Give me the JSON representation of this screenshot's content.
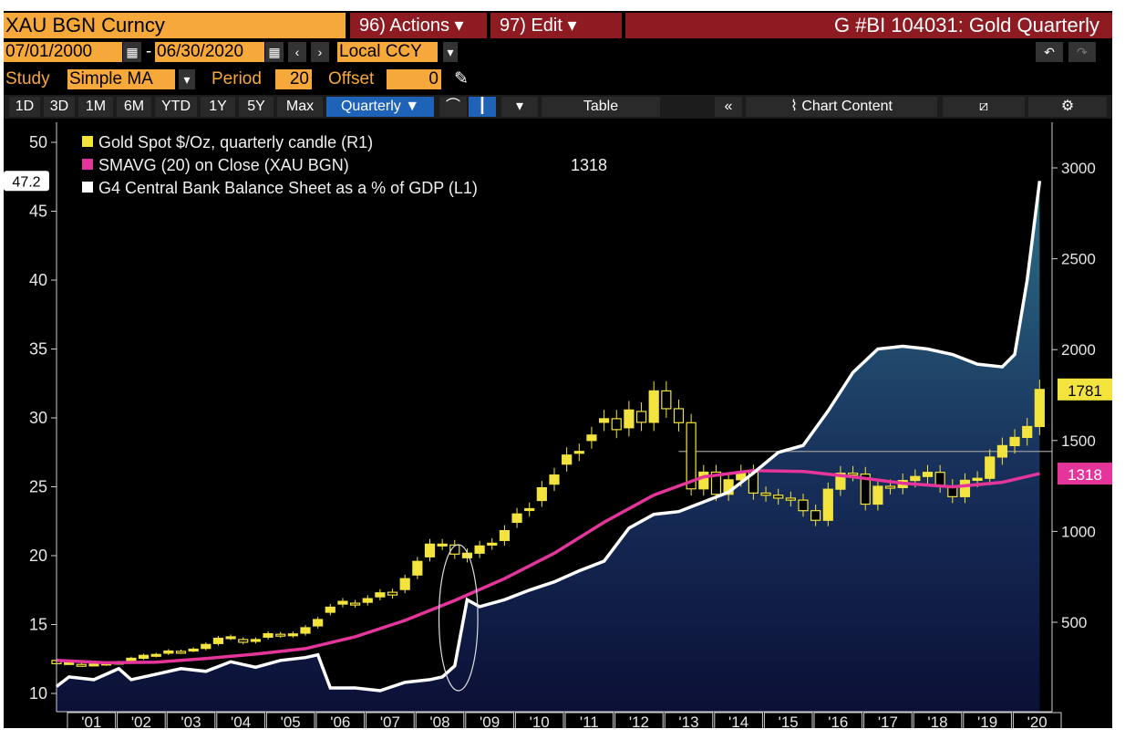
{
  "header": {
    "ticker": "XAU BGN Curncy",
    "actions_label": "96) Actions",
    "edit_label": "97) Edit",
    "title": "G #BI 104031: Gold Quarterly",
    "start_date": "07/01/2000",
    "end_date": "06/30/2020",
    "currency": "Local CCY",
    "study_label": "Study",
    "study_value": "Simple MA",
    "period_label": "Period",
    "period_value": "20",
    "offset_label": "Offset",
    "offset_value": "0"
  },
  "toolbar": {
    "tabs": [
      "1D",
      "3D",
      "1M",
      "6M",
      "YTD",
      "1Y",
      "5Y",
      "Max"
    ],
    "period_select": "Quarterly ▼",
    "table_label": "Table",
    "chart_content_label": "Chart Content"
  },
  "colors": {
    "background": "#000000",
    "gold": "#f2e33f",
    "ma": "#e3359a",
    "balance_sheet_line": "#ffffff",
    "orange": "#f7a83a",
    "dark_red": "#8e1b22",
    "selected_tab": "#1f63b8"
  },
  "chart_data": {
    "type": "line",
    "legend": [
      "Gold Spot $/Oz, quarterly candle (R1)",
      "SMAVG (20)  on Close (XAU BGN)",
      "G4 Central Bank Balance Sheet as a % of GDP (L1)"
    ],
    "legend_ma_value": "1318",
    "x_ticks": [
      "'01",
      "'02",
      "'03",
      "'04",
      "'05",
      "'06",
      "'07",
      "'08",
      "'09",
      "'10",
      "'11",
      "'12",
      "'13",
      "'14",
      "'15",
      "'16",
      "'17",
      "'18",
      "'19",
      "'20"
    ],
    "left_axis": {
      "ylim": [
        9,
        50
      ],
      "ticks": [
        "50",
        "45",
        "40",
        "35",
        "30",
        "25",
        "20",
        "15",
        "10"
      ]
    },
    "right_axis": {
      "ticks": [
        "3000",
        "2500",
        "2000",
        "1500",
        "1000",
        "500"
      ]
    },
    "left_marker": "47.2",
    "right_markers": [
      "1781",
      "1318"
    ],
    "gold_candles": [
      {
        "x": 2000.5,
        "o": 290,
        "c": 272
      },
      {
        "x": 2000.75,
        "o": 274,
        "c": 278
      },
      {
        "x": 2001.0,
        "o": 268,
        "c": 265
      },
      {
        "x": 2001.25,
        "o": 266,
        "c": 270
      },
      {
        "x": 2001.5,
        "o": 268,
        "c": 275
      },
      {
        "x": 2001.75,
        "o": 276,
        "c": 280
      },
      {
        "x": 2002.0,
        "o": 290,
        "c": 302
      },
      {
        "x": 2002.25,
        "o": 302,
        "c": 318
      },
      {
        "x": 2002.5,
        "o": 316,
        "c": 323
      },
      {
        "x": 2002.75,
        "o": 330,
        "c": 342
      },
      {
        "x": 2003.0,
        "o": 340,
        "c": 336
      },
      {
        "x": 2003.25,
        "o": 346,
        "c": 352
      },
      {
        "x": 2003.5,
        "o": 356,
        "c": 378
      },
      {
        "x": 2003.75,
        "o": 383,
        "c": 412
      },
      {
        "x": 2004.0,
        "o": 414,
        "c": 420
      },
      {
        "x": 2004.25,
        "o": 405,
        "c": 390
      },
      {
        "x": 2004.5,
        "o": 395,
        "c": 405
      },
      {
        "x": 2004.75,
        "o": 418,
        "c": 437
      },
      {
        "x": 2005.0,
        "o": 434,
        "c": 427
      },
      {
        "x": 2005.25,
        "o": 428,
        "c": 436
      },
      {
        "x": 2005.5,
        "o": 440,
        "c": 470
      },
      {
        "x": 2005.75,
        "o": 480,
        "c": 515
      },
      {
        "x": 2006.0,
        "o": 555,
        "c": 583
      },
      {
        "x": 2006.25,
        "o": 600,
        "c": 615
      },
      {
        "x": 2006.5,
        "o": 605,
        "c": 598
      },
      {
        "x": 2006.75,
        "o": 610,
        "c": 630
      },
      {
        "x": 2007.0,
        "o": 640,
        "c": 662
      },
      {
        "x": 2007.25,
        "o": 665,
        "c": 650
      },
      {
        "x": 2007.5,
        "o": 680,
        "c": 740
      },
      {
        "x": 2007.75,
        "o": 760,
        "c": 835
      },
      {
        "x": 2008.0,
        "o": 860,
        "c": 930
      },
      {
        "x": 2008.25,
        "o": 925,
        "c": 930
      },
      {
        "x": 2008.5,
        "o": 925,
        "c": 875
      },
      {
        "x": 2008.75,
        "o": 855,
        "c": 880
      },
      {
        "x": 2009.0,
        "o": 880,
        "c": 920
      },
      {
        "x": 2009.25,
        "o": 926,
        "c": 935
      },
      {
        "x": 2009.5,
        "o": 950,
        "c": 1004
      },
      {
        "x": 2009.75,
        "o": 1050,
        "c": 1096
      },
      {
        "x": 2010.0,
        "o": 1115,
        "c": 1125
      },
      {
        "x": 2010.25,
        "o": 1170,
        "c": 1240
      },
      {
        "x": 2010.5,
        "o": 1260,
        "c": 1310
      },
      {
        "x": 2010.75,
        "o": 1370,
        "c": 1420
      },
      {
        "x": 2011.0,
        "o": 1430,
        "c": 1440
      },
      {
        "x": 2011.25,
        "o": 1500,
        "c": 1530
      },
      {
        "x": 2011.5,
        "o": 1600,
        "c": 1620
      },
      {
        "x": 2011.75,
        "o": 1620,
        "c": 1560
      },
      {
        "x": 2012.0,
        "o": 1570,
        "c": 1668
      },
      {
        "x": 2012.25,
        "o": 1660,
        "c": 1600
      },
      {
        "x": 2012.5,
        "o": 1600,
        "c": 1773
      },
      {
        "x": 2012.75,
        "o": 1773,
        "c": 1675
      },
      {
        "x": 2013.0,
        "o": 1675,
        "c": 1598
      },
      {
        "x": 2013.25,
        "o": 1598,
        "c": 1234
      },
      {
        "x": 2013.5,
        "o": 1234,
        "c": 1326
      },
      {
        "x": 2013.75,
        "o": 1326,
        "c": 1204
      },
      {
        "x": 2014.0,
        "o": 1204,
        "c": 1284
      },
      {
        "x": 2014.25,
        "o": 1284,
        "c": 1327
      },
      {
        "x": 2014.5,
        "o": 1327,
        "c": 1211
      },
      {
        "x": 2014.75,
        "o": 1211,
        "c": 1199
      },
      {
        "x": 2015.0,
        "o": 1199,
        "c": 1183
      },
      {
        "x": 2015.25,
        "o": 1183,
        "c": 1172
      },
      {
        "x": 2015.5,
        "o": 1172,
        "c": 1114
      },
      {
        "x": 2015.75,
        "o": 1114,
        "c": 1061
      },
      {
        "x": 2016.0,
        "o": 1061,
        "c": 1232
      },
      {
        "x": 2016.25,
        "o": 1232,
        "c": 1320
      },
      {
        "x": 2016.5,
        "o": 1320,
        "c": 1315
      },
      {
        "x": 2016.75,
        "o": 1315,
        "c": 1150
      },
      {
        "x": 2017.0,
        "o": 1150,
        "c": 1248
      },
      {
        "x": 2017.25,
        "o": 1248,
        "c": 1241
      },
      {
        "x": 2017.5,
        "o": 1241,
        "c": 1280
      },
      {
        "x": 2017.75,
        "o": 1280,
        "c": 1302
      },
      {
        "x": 2018.0,
        "o": 1302,
        "c": 1325
      },
      {
        "x": 2018.25,
        "o": 1325,
        "c": 1250
      },
      {
        "x": 2018.5,
        "o": 1250,
        "c": 1191
      },
      {
        "x": 2018.75,
        "o": 1191,
        "c": 1281
      },
      {
        "x": 2019.0,
        "o": 1281,
        "c": 1292
      },
      {
        "x": 2019.25,
        "o": 1292,
        "c": 1409
      },
      {
        "x": 2019.5,
        "o": 1409,
        "c": 1472
      },
      {
        "x": 2019.75,
        "o": 1472,
        "c": 1517
      },
      {
        "x": 2020.0,
        "o": 1517,
        "c": 1577
      },
      {
        "x": 2020.25,
        "o": 1577,
        "c": 1781
      }
    ],
    "sma_series": [
      {
        "x": 2000.5,
        "y": 290
      },
      {
        "x": 2001.5,
        "y": 277
      },
      {
        "x": 2002.5,
        "y": 280
      },
      {
        "x": 2003.5,
        "y": 300
      },
      {
        "x": 2004.5,
        "y": 325
      },
      {
        "x": 2005.5,
        "y": 355
      },
      {
        "x": 2006.5,
        "y": 420
      },
      {
        "x": 2007.5,
        "y": 510
      },
      {
        "x": 2008.5,
        "y": 620
      },
      {
        "x": 2009.5,
        "y": 740
      },
      {
        "x": 2010.5,
        "y": 880
      },
      {
        "x": 2011.5,
        "y": 1050
      },
      {
        "x": 2012.5,
        "y": 1200
      },
      {
        "x": 2013.5,
        "y": 1300
      },
      {
        "x": 2014.5,
        "y": 1335
      },
      {
        "x": 2015.5,
        "y": 1330
      },
      {
        "x": 2016.5,
        "y": 1300
      },
      {
        "x": 2017.5,
        "y": 1265
      },
      {
        "x": 2018.5,
        "y": 1245
      },
      {
        "x": 2019.5,
        "y": 1270
      },
      {
        "x": 2020.25,
        "y": 1318
      }
    ],
    "balance_sheet_series": [
      {
        "x": 2000.5,
        "y": 10.5
      },
      {
        "x": 2000.75,
        "y": 11.2
      },
      {
        "x": 2001.25,
        "y": 11.0
      },
      {
        "x": 2001.75,
        "y": 11.8
      },
      {
        "x": 2002.0,
        "y": 11.0
      },
      {
        "x": 2002.5,
        "y": 11.4
      },
      {
        "x": 2003.0,
        "y": 11.8
      },
      {
        "x": 2003.5,
        "y": 11.6
      },
      {
        "x": 2004.0,
        "y": 12.3
      },
      {
        "x": 2004.5,
        "y": 11.9
      },
      {
        "x": 2005.0,
        "y": 12.4
      },
      {
        "x": 2005.5,
        "y": 12.6
      },
      {
        "x": 2005.75,
        "y": 12.8
      },
      {
        "x": 2006.0,
        "y": 10.4
      },
      {
        "x": 2006.5,
        "y": 10.4
      },
      {
        "x": 2007.0,
        "y": 10.2
      },
      {
        "x": 2007.5,
        "y": 10.8
      },
      {
        "x": 2008.0,
        "y": 11.0
      },
      {
        "x": 2008.25,
        "y": 11.2
      },
      {
        "x": 2008.5,
        "y": 12.0
      },
      {
        "x": 2008.75,
        "y": 16.8
      },
      {
        "x": 2009.0,
        "y": 16.3
      },
      {
        "x": 2009.5,
        "y": 16.8
      },
      {
        "x": 2010.0,
        "y": 17.5
      },
      {
        "x": 2010.5,
        "y": 18.1
      },
      {
        "x": 2011.0,
        "y": 18.9
      },
      {
        "x": 2011.5,
        "y": 19.6
      },
      {
        "x": 2012.0,
        "y": 22.0
      },
      {
        "x": 2012.5,
        "y": 23.0
      },
      {
        "x": 2013.0,
        "y": 23.2
      },
      {
        "x": 2013.5,
        "y": 23.9
      },
      {
        "x": 2014.0,
        "y": 24.6
      },
      {
        "x": 2014.5,
        "y": 26.0
      },
      {
        "x": 2015.0,
        "y": 27.5
      },
      {
        "x": 2015.5,
        "y": 28.0
      },
      {
        "x": 2016.0,
        "y": 30.5
      },
      {
        "x": 2016.5,
        "y": 33.3
      },
      {
        "x": 2017.0,
        "y": 35.0
      },
      {
        "x": 2017.5,
        "y": 35.2
      },
      {
        "x": 2018.0,
        "y": 35.0
      },
      {
        "x": 2018.5,
        "y": 34.6
      },
      {
        "x": 2019.0,
        "y": 33.9
      },
      {
        "x": 2019.5,
        "y": 33.7
      },
      {
        "x": 2019.75,
        "y": 34.6
      },
      {
        "x": 2020.0,
        "y": 40.0
      },
      {
        "x": 2020.25,
        "y": 47.2
      }
    ],
    "reference_line_value": 1440,
    "highlight_ellipse_x": [
      2008.0,
      2009.0
    ]
  }
}
